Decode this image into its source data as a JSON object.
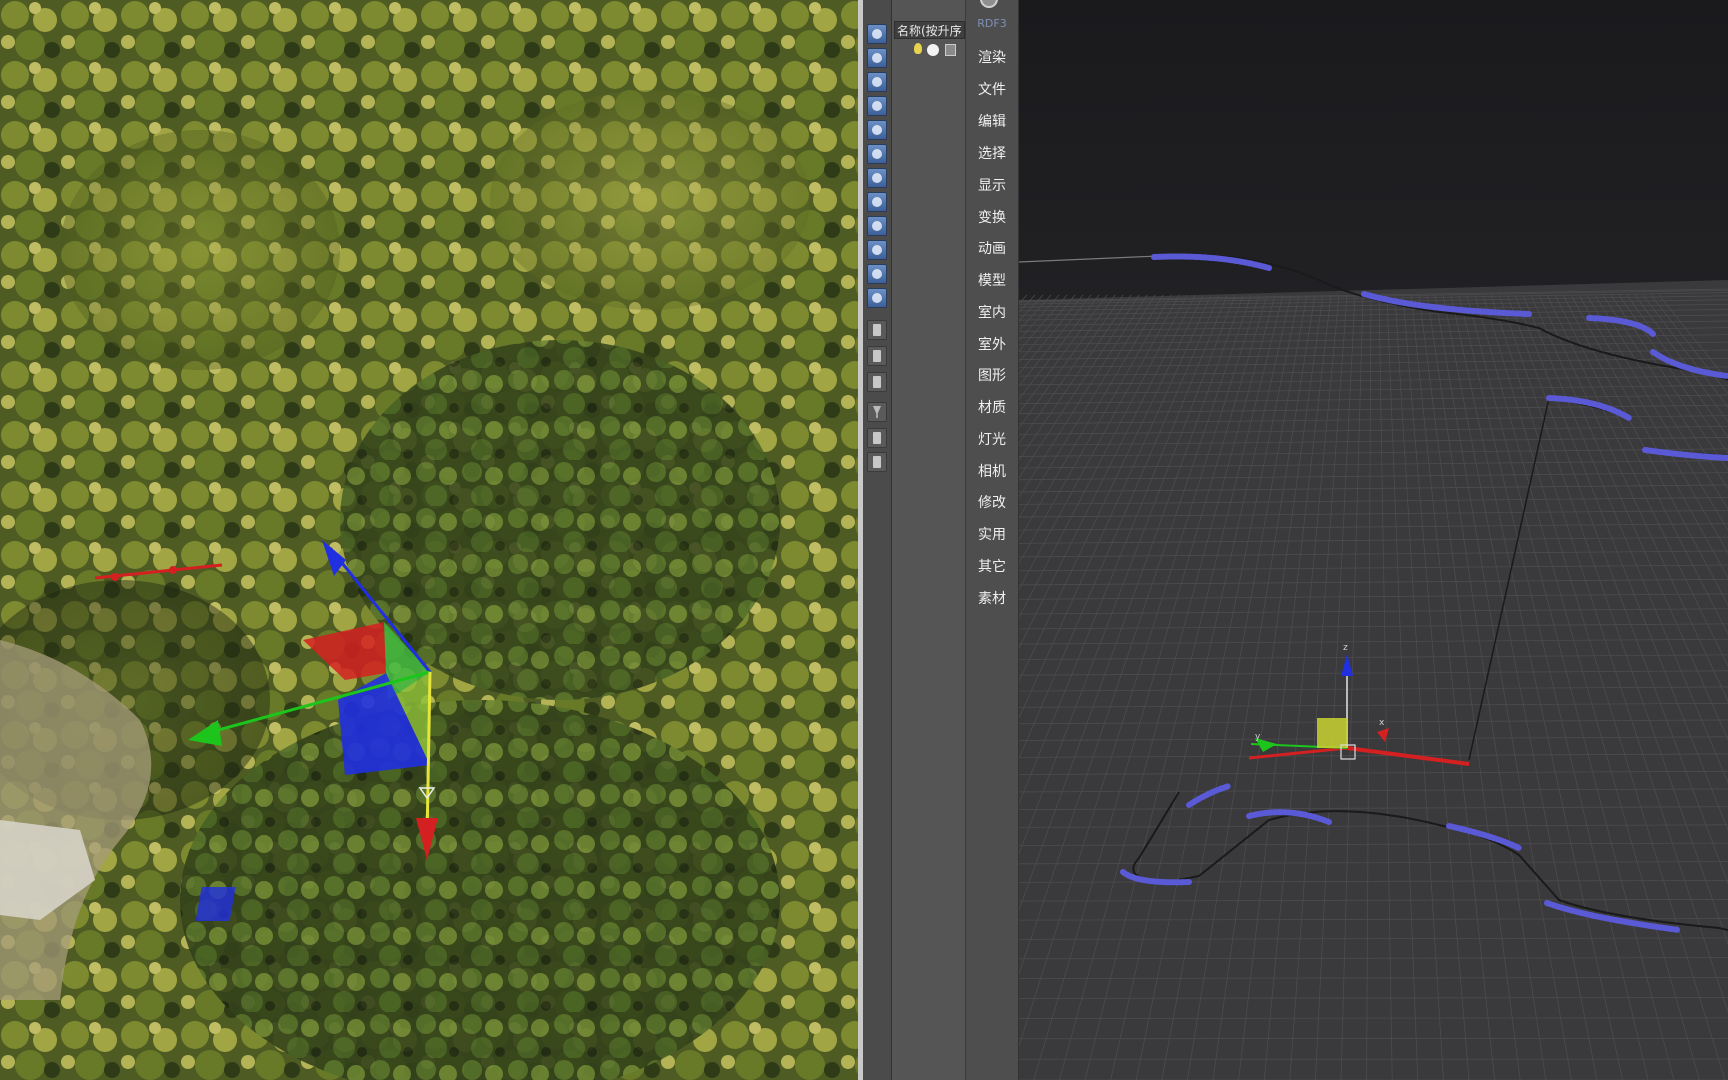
{
  "left_viewport": {
    "axis_labels": {
      "x": "",
      "y": "",
      "z": ""
    }
  },
  "toolbar": {
    "icons": [
      "scene-icon",
      "select-icon",
      "link-icon",
      "filter-icon",
      "camera-icon",
      "light-icon",
      "shape-icon",
      "geometry-icon",
      "helper-icon",
      "space-icon",
      "group-icon",
      "layer-icon",
      "list-icon",
      "doc-icon",
      "display-icon",
      "funnel-icon",
      "funnel-options-icon",
      "sort-icon"
    ]
  },
  "scene_explorer": {
    "column_header": "名称(按升序"
  },
  "side_menu": {
    "brand": "RDF3",
    "items": [
      "渲染",
      "文件",
      "编辑",
      "选择",
      "显示",
      "变换",
      "动画",
      "模型",
      "室内",
      "室外",
      "图形",
      "材质",
      "灯光",
      "相机",
      "修改",
      "实用",
      "其它",
      "素材"
    ]
  },
  "right_viewport": {
    "gizmo_labels": {
      "x": "x",
      "y": "y",
      "z": "z"
    }
  },
  "colors": {
    "accent_blue": "#5a5ad6",
    "axis_x": "#d42020",
    "axis_y": "#1cc41c",
    "axis_z": "#2030e0",
    "gizmo_plane": "#c9d430"
  }
}
